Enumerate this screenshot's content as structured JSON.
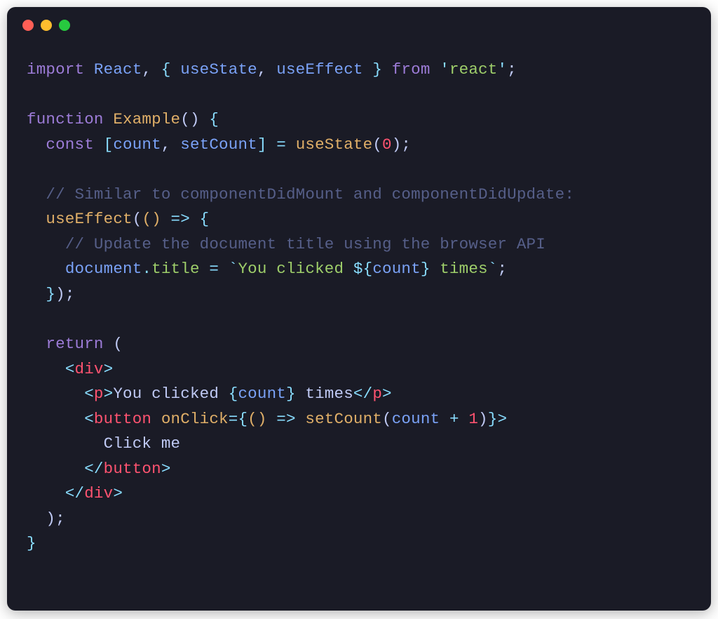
{
  "colors": {
    "background": "#1a1b26",
    "red": "#ff5f56",
    "yellow": "#ffbd2e",
    "green": "#27c93f"
  },
  "code": {
    "l1": {
      "kw_import": "import",
      "react": "React",
      "comma": ",",
      "lb": "{",
      "useState": "useState",
      "comma2": ",",
      "useEffect": "useEffect",
      "rb": "}",
      "kw_from": "from",
      "q": "'",
      "module": "react",
      "sc": ";"
    },
    "l3": {
      "kw_function": "function",
      "name": "Example",
      "lp": "(",
      "rp": ")",
      "lb": "{"
    },
    "l4": {
      "kw_const": "const",
      "lsq": "[",
      "count": "count",
      "comma": ",",
      "setCount": "setCount",
      "rsq": "]",
      "eq": "=",
      "useState": "useState",
      "lp": "(",
      "zero": "0",
      "rp": ")",
      "sc": ";"
    },
    "l6": {
      "comment": "// Similar to componentDidMount and componentDidUpdate:"
    },
    "l7": {
      "useEffect": "useEffect",
      "lp": "(",
      "lp2": "(",
      "rp2": ")",
      "arrow": "=>",
      "lb": "{"
    },
    "l8": {
      "comment": "// Update the document title using the browser API"
    },
    "l9": {
      "document": "document",
      "dot": ".",
      "title": "title",
      "eq": "=",
      "bt1": "`",
      "txt1": "You clicked ",
      "dol": "${",
      "count": "count",
      "cb": "}",
      "txt2": " times",
      "bt2": "`",
      "sc": ";"
    },
    "l10": {
      "rb": "}",
      "rp": ")",
      "sc": ";"
    },
    "l12": {
      "kw_return": "return",
      "lp": "("
    },
    "l13": {
      "lt": "<",
      "tag": "div",
      "gt": ">"
    },
    "l14": {
      "lt": "<",
      "tag": "p",
      "gt": ">",
      "txt1": "You clicked ",
      "lb": "{",
      "count": "count",
      "rb": "}",
      "txt2": " times",
      "lt2": "</",
      "tag2": "p",
      "gt2": ">"
    },
    "l15": {
      "lt": "<",
      "tag": "button",
      "attr": "onClick",
      "eq": "=",
      "lb": "{",
      "lp": "(",
      "rp": ")",
      "arrow": "=>",
      "setCount": "setCount",
      "lp2": "(",
      "count": "count",
      "plus": "+",
      "one": "1",
      "rp2": ")",
      "rb": "}",
      "gt": ">"
    },
    "l16": {
      "txt": "Click me"
    },
    "l17": {
      "lt": "</",
      "tag": "button",
      "gt": ">"
    },
    "l18": {
      "lt": "</",
      "tag": "div",
      "gt": ">"
    },
    "l19": {
      "rp": ")",
      "sc": ";"
    },
    "l20": {
      "rb": "}"
    }
  }
}
